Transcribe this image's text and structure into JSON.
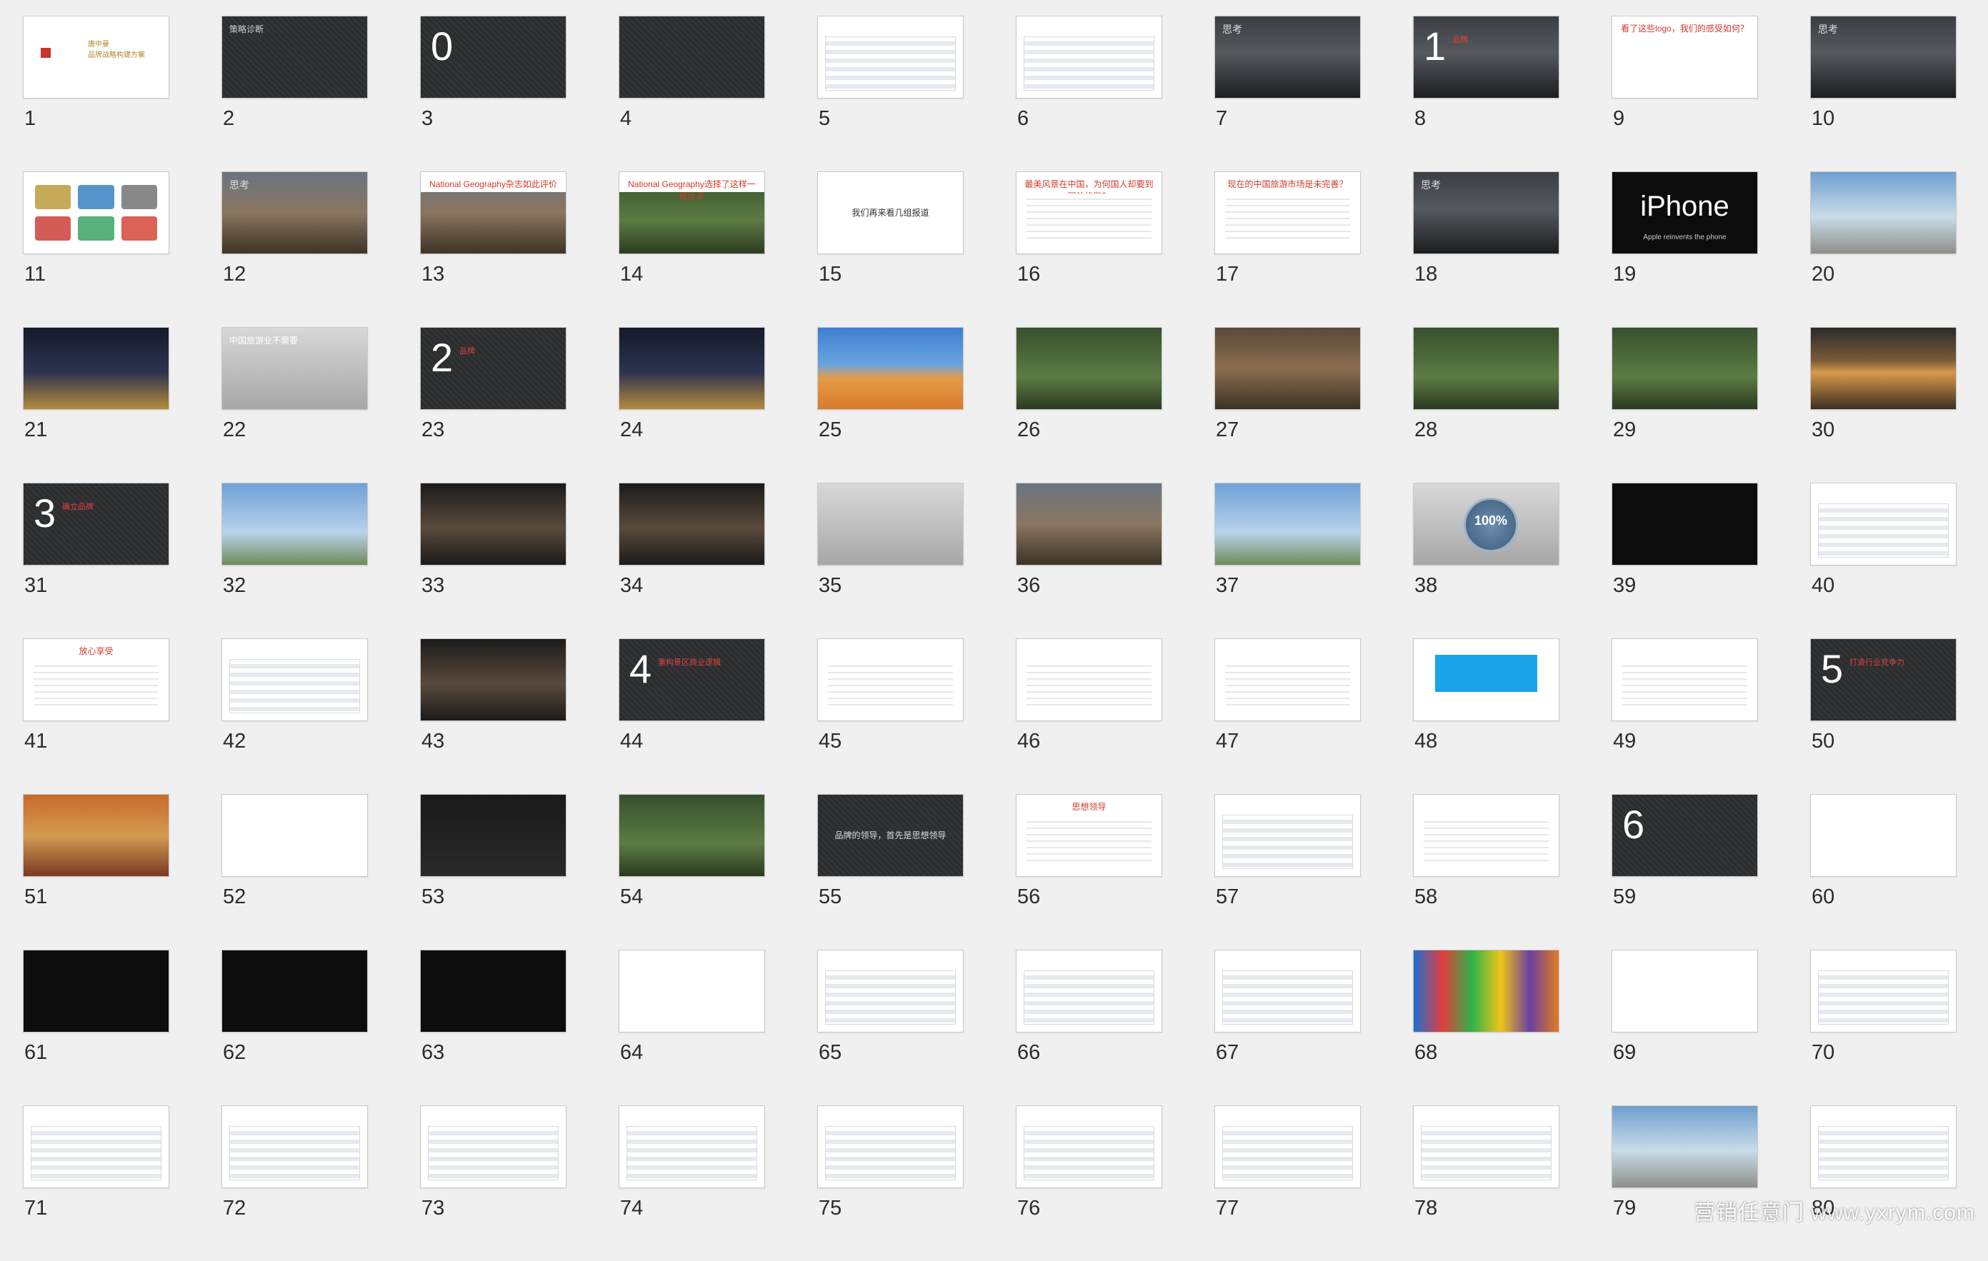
{
  "watermark": "营销任意门 www.yxrym.com",
  "colors": {
    "accent_red": "#d33a2c",
    "background": "#f0f0f0",
    "highlight_blue": "#1aa3e8"
  },
  "slides": [
    {
      "n": "1",
      "bg": "white",
      "kind": "title",
      "title": "唐中曼\n品牌战略构建方案",
      "title_color": "#b08a2e",
      "icon": "brand-logo-icon"
    },
    {
      "n": "2",
      "bg": "chalk",
      "kind": "text",
      "title": "策略诊断",
      "title_color": "#cfcfcf"
    },
    {
      "n": "3",
      "bg": "chalk",
      "kind": "section",
      "big": "0",
      "sub": ""
    },
    {
      "n": "4",
      "bg": "chalk",
      "kind": "text",
      "title": "",
      "title_color": "#a8d26b"
    },
    {
      "n": "5",
      "bg": "white",
      "kind": "table",
      "title": ""
    },
    {
      "n": "6",
      "bg": "white",
      "kind": "table",
      "title": ""
    },
    {
      "n": "7",
      "bg": "storm",
      "kind": "thought",
      "title": "思考"
    },
    {
      "n": "8",
      "bg": "storm",
      "kind": "section",
      "big": "1",
      "sub": "品牌"
    },
    {
      "n": "9",
      "bg": "white",
      "kind": "logos",
      "title": "看了这些logo，我们的感受如何？",
      "title_color": "#d33a2c"
    },
    {
      "n": "10",
      "bg": "storm",
      "kind": "thought",
      "title": "思考"
    },
    {
      "n": "11",
      "bg": "white",
      "kind": "icons",
      "title": ""
    },
    {
      "n": "12",
      "bg": "photo-mtn",
      "kind": "thought",
      "title": "思考"
    },
    {
      "n": "13",
      "bg": "photo-mtn",
      "kind": "redtitle",
      "title": "National Geography杂志如此评价",
      "title_color": "#d33a2c",
      "white_top": true
    },
    {
      "n": "14",
      "bg": "photo-forest",
      "kind": "redtitle",
      "title": "National Geography选择了这样一组片子",
      "title_color": "#d33a2c",
      "white_top": true
    },
    {
      "n": "15",
      "bg": "white",
      "kind": "center",
      "title": "我们再来看几组报道",
      "title_color": "#333333"
    },
    {
      "n": "16",
      "bg": "white",
      "kind": "redtitle",
      "title": "最美风景在中国，为何国人却要到国外旅游？",
      "title_color": "#d33a2c"
    },
    {
      "n": "17",
      "bg": "white",
      "kind": "redtitle",
      "title": "现在的中国旅游市场是未完善？",
      "title_color": "#d33a2c"
    },
    {
      "n": "18",
      "bg": "storm",
      "kind": "thought",
      "title": "思考"
    },
    {
      "n": "19",
      "bg": "photo-black",
      "kind": "iphone",
      "title": "iPhone",
      "small": "Apple reinvents the phone"
    },
    {
      "n": "20",
      "bg": "photo-sky",
      "kind": "text",
      "title": "",
      "title_color": "#ffffff"
    },
    {
      "n": "21",
      "bg": "photo-night",
      "kind": "text",
      "title": "",
      "title_color": "#ffffff"
    },
    {
      "n": "22",
      "bg": "photo-grey",
      "kind": "text",
      "title": "中国旅游业不需要",
      "title_color": "#ffffff"
    },
    {
      "n": "23",
      "bg": "chalk",
      "kind": "section",
      "big": "2",
      "sub": "品牌"
    },
    {
      "n": "24",
      "bg": "photo-night",
      "kind": "text",
      "title": "",
      "title_color": "#ffffff"
    },
    {
      "n": "25",
      "bg": "photo-desert",
      "kind": "text",
      "title": "",
      "title_color": "#ffffff"
    },
    {
      "n": "26",
      "bg": "photo-forest",
      "kind": "text",
      "title": "",
      "title_color": "#ffffff"
    },
    {
      "n": "27",
      "bg": "photo-crowd",
      "kind": "text",
      "title": "",
      "title_color": "#ffffff"
    },
    {
      "n": "28",
      "bg": "photo-forest",
      "kind": "text",
      "title": "",
      "title_color": "#ffffff"
    },
    {
      "n": "29",
      "bg": "photo-forest",
      "kind": "text",
      "title": "",
      "title_color": "#ffffff"
    },
    {
      "n": "30",
      "bg": "photo-sunset",
      "kind": "text",
      "title": "",
      "title_color": "#ffffff"
    },
    {
      "n": "31",
      "bg": "chalk",
      "kind": "section",
      "big": "3",
      "sub": "确立品牌"
    },
    {
      "n": "32",
      "bg": "photo-blue",
      "kind": "text",
      "title": "",
      "title_color": "#ffffff"
    },
    {
      "n": "33",
      "bg": "photo-car",
      "kind": "text",
      "title": "",
      "title_color": "#ffffff"
    },
    {
      "n": "34",
      "bg": "photo-car",
      "kind": "text",
      "title": "",
      "title_color": "#ffffff"
    },
    {
      "n": "35",
      "bg": "photo-grey",
      "kind": "text",
      "title": "",
      "title_color": "#333333"
    },
    {
      "n": "36",
      "bg": "photo-mtn",
      "kind": "text",
      "title": "",
      "title_color": "#ffffff"
    },
    {
      "n": "37",
      "bg": "photo-blue",
      "kind": "text",
      "title": "",
      "title_color": "#ffffff"
    },
    {
      "n": "38",
      "bg": "photo-grey",
      "kind": "badge",
      "title": "100%"
    },
    {
      "n": "39",
      "bg": "photo-black",
      "kind": "text",
      "title": "",
      "title_color": "#ffffff"
    },
    {
      "n": "40",
      "bg": "white",
      "kind": "table",
      "title": ""
    },
    {
      "n": "41",
      "bg": "white",
      "kind": "redtitle",
      "title": "放心享受",
      "title_color": "#d33a2c"
    },
    {
      "n": "42",
      "bg": "white",
      "kind": "table",
      "title": ""
    },
    {
      "n": "43",
      "bg": "photo-car",
      "kind": "text",
      "title": "",
      "title_color": "#ffffff"
    },
    {
      "n": "44",
      "bg": "chalk",
      "kind": "section",
      "big": "4",
      "sub": "重构景区商业逻辑"
    },
    {
      "n": "45",
      "bg": "white",
      "kind": "redtitle",
      "title": "",
      "title_color": "#d33a2c"
    },
    {
      "n": "46",
      "bg": "white",
      "kind": "redtitle",
      "title": "",
      "title_color": "#d33a2c"
    },
    {
      "n": "47",
      "bg": "white",
      "kind": "redtitle",
      "title": "",
      "title_color": "#d33a2c"
    },
    {
      "n": "48",
      "bg": "white",
      "kind": "hilite",
      "title": ""
    },
    {
      "n": "49",
      "bg": "white",
      "kind": "redtitle",
      "title": "",
      "title_color": "#d33a2c"
    },
    {
      "n": "50",
      "bg": "chalk",
      "kind": "section",
      "big": "5",
      "sub": "打造行业竞争力"
    },
    {
      "n": "51",
      "bg": "photo-poster",
      "kind": "text",
      "title": "",
      "title_color": "#ffffff"
    },
    {
      "n": "52",
      "bg": "white",
      "kind": "text",
      "title": "",
      "title_color": "#333333"
    },
    {
      "n": "53",
      "bg": "photo-blacklite",
      "kind": "text",
      "title": "",
      "title_color": "#ffffff"
    },
    {
      "n": "54",
      "bg": "photo-forest",
      "kind": "text",
      "title": "",
      "title_color": "#ffffff"
    },
    {
      "n": "55",
      "bg": "chalk",
      "kind": "center",
      "title": "品牌的领导，首先是思想领导",
      "title_color": "#dcdcdc"
    },
    {
      "n": "56",
      "bg": "white",
      "kind": "redtitle",
      "title": "思想领导",
      "title_color": "#d33a2c"
    },
    {
      "n": "57",
      "bg": "white",
      "kind": "table",
      "title": ""
    },
    {
      "n": "58",
      "bg": "white",
      "kind": "redtitle",
      "title": "",
      "title_color": "#d33a2c"
    },
    {
      "n": "59",
      "bg": "chalk",
      "kind": "section",
      "big": "6",
      "sub": ""
    },
    {
      "n": "60",
      "bg": "white",
      "kind": "center",
      "title": "",
      "title_color": "#555555"
    },
    {
      "n": "61",
      "bg": "photo-black",
      "kind": "text",
      "title": "",
      "title_color": "#ffffff"
    },
    {
      "n": "62",
      "bg": "photo-black",
      "kind": "text",
      "title": "",
      "title_color": "#ffffff"
    },
    {
      "n": "63",
      "bg": "photo-black",
      "kind": "text",
      "title": "",
      "title_color": "#ffffff"
    },
    {
      "n": "64",
      "bg": "white",
      "kind": "center",
      "title": "",
      "title_color": "#555555"
    },
    {
      "n": "65",
      "bg": "white",
      "kind": "table",
      "title": ""
    },
    {
      "n": "66",
      "bg": "white",
      "kind": "table",
      "title": ""
    },
    {
      "n": "67",
      "bg": "white",
      "kind": "table",
      "title": ""
    },
    {
      "n": "68",
      "bg": "photo-colors",
      "kind": "text",
      "title": "",
      "title_color": "#ffffff"
    },
    {
      "n": "69",
      "bg": "white",
      "kind": "logos",
      "title": "",
      "title_color": "#333333"
    },
    {
      "n": "70",
      "bg": "white",
      "kind": "table",
      "title": ""
    },
    {
      "n": "71",
      "bg": "white",
      "kind": "table",
      "title": ""
    },
    {
      "n": "72",
      "bg": "white",
      "kind": "table",
      "title": ""
    },
    {
      "n": "73",
      "bg": "white",
      "kind": "table",
      "title": ""
    },
    {
      "n": "74",
      "bg": "white",
      "kind": "table",
      "title": ""
    },
    {
      "n": "75",
      "bg": "white",
      "kind": "table",
      "title": ""
    },
    {
      "n": "76",
      "bg": "white",
      "kind": "table",
      "title": ""
    },
    {
      "n": "77",
      "bg": "white",
      "kind": "table",
      "title": ""
    },
    {
      "n": "78",
      "bg": "white",
      "kind": "table",
      "title": ""
    },
    {
      "n": "79",
      "bg": "photo-sky",
      "kind": "text",
      "title": "",
      "title_color": "#ffffff"
    },
    {
      "n": "80",
      "bg": "white",
      "kind": "table",
      "title": ""
    }
  ]
}
